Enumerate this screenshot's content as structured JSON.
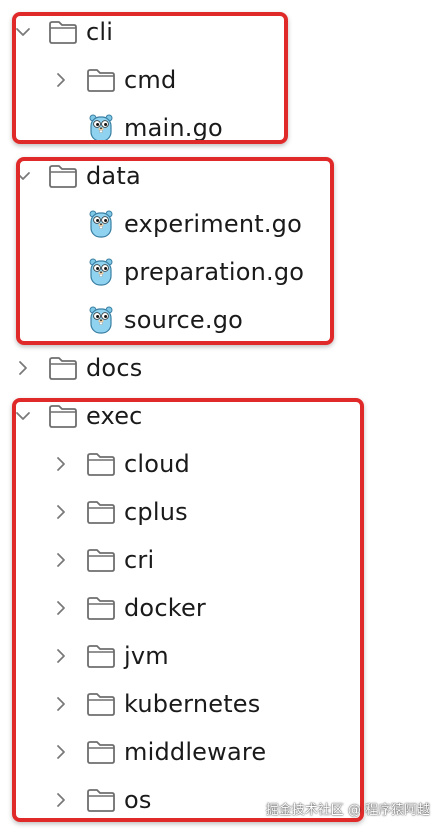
{
  "tree": [
    {
      "label": "cli",
      "type": "folder",
      "level": 0,
      "expanded": true,
      "icon": "folder-icon"
    },
    {
      "label": "cmd",
      "type": "folder",
      "level": 1,
      "expanded": false,
      "icon": "folder-icon"
    },
    {
      "label": "main.go",
      "type": "file",
      "level": 1,
      "icon": "gopher-icon"
    },
    {
      "label": "data",
      "type": "folder",
      "level": 0,
      "expanded": true,
      "icon": "folder-icon"
    },
    {
      "label": "experiment.go",
      "type": "file",
      "level": 1,
      "icon": "gopher-icon"
    },
    {
      "label": "preparation.go",
      "type": "file",
      "level": 1,
      "icon": "gopher-icon"
    },
    {
      "label": "source.go",
      "type": "file",
      "level": 1,
      "icon": "gopher-icon"
    },
    {
      "label": "docs",
      "type": "folder",
      "level": 0,
      "expanded": false,
      "icon": "folder-icon"
    },
    {
      "label": "exec",
      "type": "folder",
      "level": 0,
      "expanded": true,
      "icon": "folder-icon"
    },
    {
      "label": "cloud",
      "type": "folder",
      "level": 1,
      "expanded": false,
      "icon": "folder-icon"
    },
    {
      "label": "cplus",
      "type": "folder",
      "level": 1,
      "expanded": false,
      "icon": "folder-icon"
    },
    {
      "label": "cri",
      "type": "folder",
      "level": 1,
      "expanded": false,
      "icon": "folder-icon"
    },
    {
      "label": "docker",
      "type": "folder",
      "level": 1,
      "expanded": false,
      "icon": "folder-icon"
    },
    {
      "label": "jvm",
      "type": "folder",
      "level": 1,
      "expanded": false,
      "icon": "folder-icon"
    },
    {
      "label": "kubernetes",
      "type": "folder",
      "level": 1,
      "expanded": false,
      "icon": "folder-icon"
    },
    {
      "label": "middleware",
      "type": "folder",
      "level": 1,
      "expanded": false,
      "icon": "folder-icon"
    },
    {
      "label": "os",
      "type": "folder",
      "level": 1,
      "expanded": false,
      "icon": "folder-icon"
    }
  ],
  "highlight_color": "#e02a2a",
  "watermark": "掘金技术社区 @ 程序猿阿越"
}
